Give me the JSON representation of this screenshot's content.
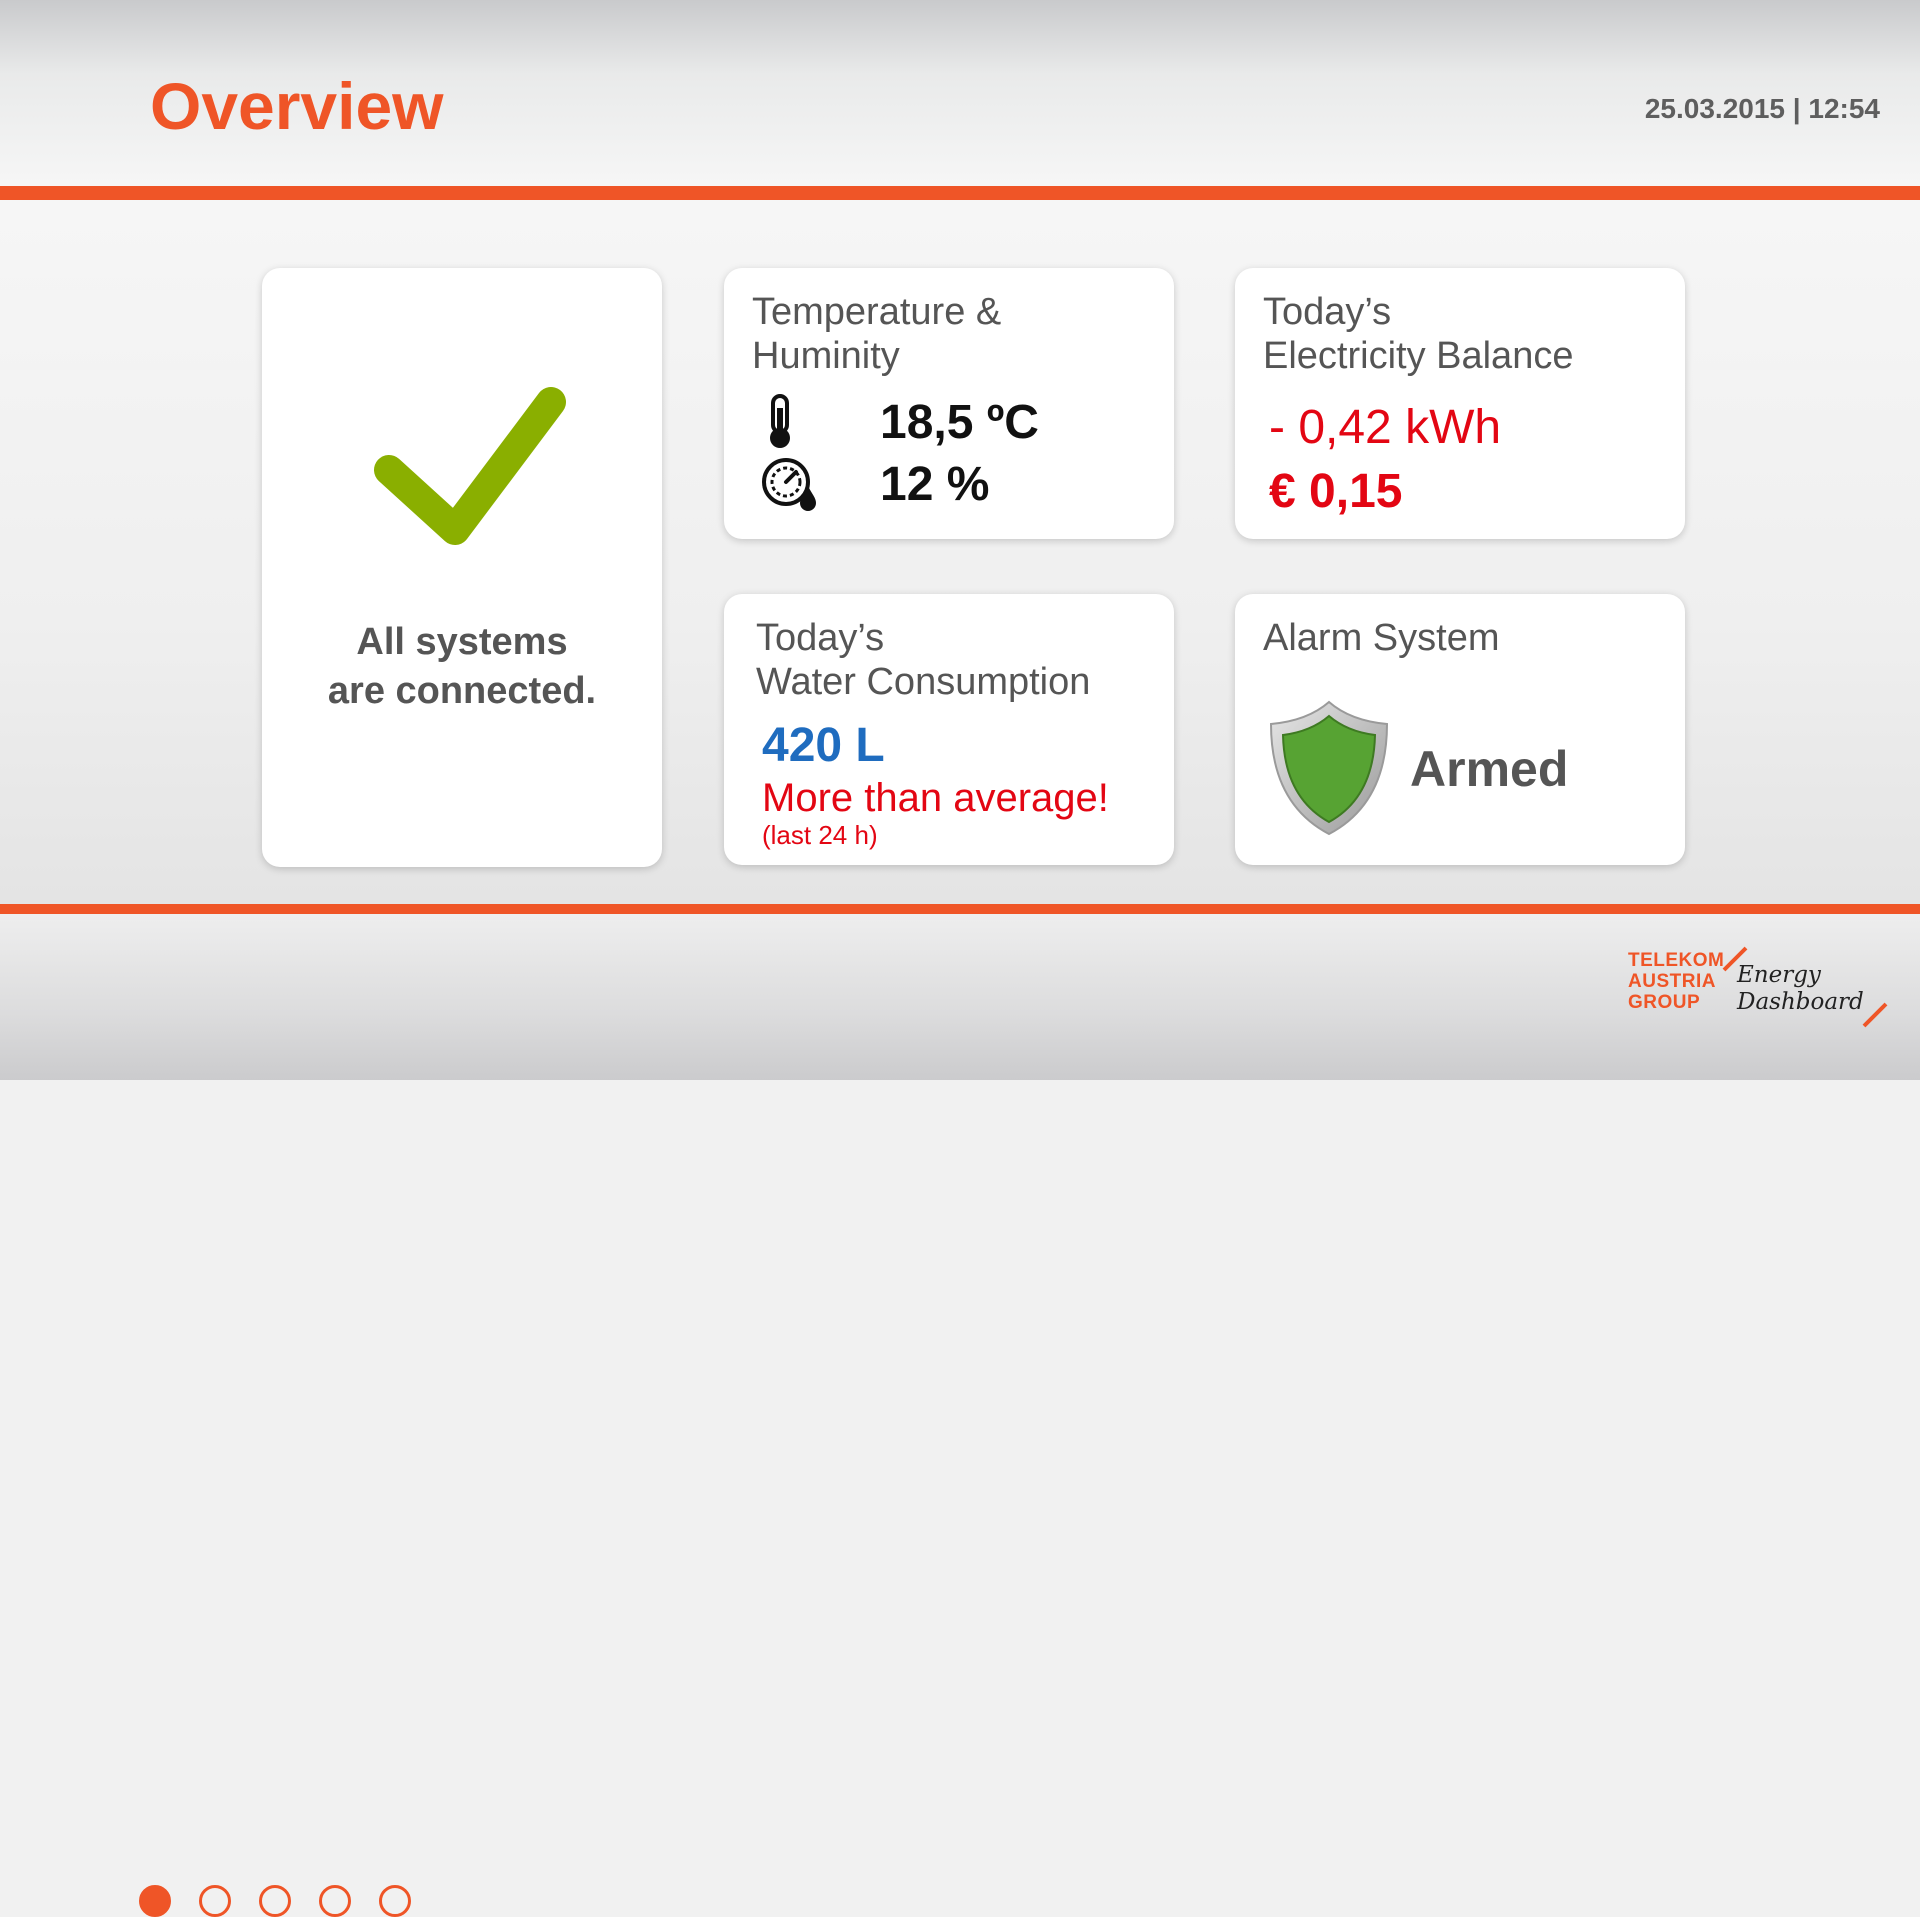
{
  "header": {
    "title": "Overview",
    "datetime": "25.03.2015 | 12:54"
  },
  "status_card": {
    "line1": "All systems",
    "line2": "are connected."
  },
  "temperature_card": {
    "title_line1": "Temperature &",
    "title_line2": "Huminity",
    "temperature": "18,5 ºC",
    "humidity": "12 %"
  },
  "electricity_card": {
    "title_line1": "Today’s",
    "title_line2": "Electricity Balance",
    "balance": "- 0,42 kWh",
    "cost": "€ 0,15"
  },
  "water_card": {
    "title_line1": "Today’s",
    "title_line2": "Water Consumption",
    "amount": "420 L",
    "message": "More than average!",
    "period": "(last 24 h)"
  },
  "alarm_card": {
    "title": "Alarm System",
    "state": "Armed"
  },
  "pager": {
    "total": 5,
    "active": 1
  },
  "brand": {
    "line1": "TELEKOM",
    "line2": "AUSTRIA",
    "line3": "GROUP",
    "product_line1": "Energy",
    "product_line2": "Dashboard"
  },
  "colors": {
    "accent": "#ef5527",
    "check": "#8aaf00",
    "shield": "#57a333",
    "alert": "#e30613",
    "water": "#1f6cbf"
  },
  "icons": {
    "status": "checkmark-icon",
    "temperature": "thermometer-icon",
    "humidity": "humidity-gauge-icon",
    "alarm": "shield-icon"
  }
}
